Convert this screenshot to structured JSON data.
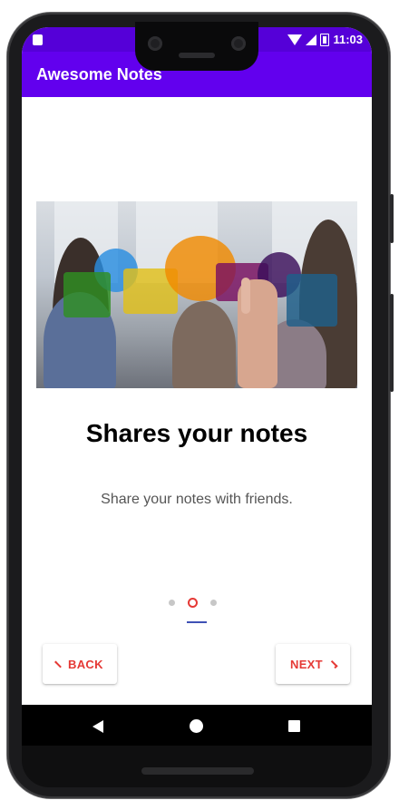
{
  "app": {
    "title": "Awesome Notes"
  },
  "status_bar": {
    "time": "11:03",
    "icons": [
      "sim-card-icon",
      "wifi-icon",
      "signal-icon",
      "battery-icon"
    ]
  },
  "onboarding": {
    "headline": "Shares your notes",
    "description": "Share your notes with friends.",
    "illustration": "people-chat-bubbles-illustration",
    "page_current": 2,
    "page_total": 3
  },
  "buttons": {
    "back_label": "BACK",
    "next_label": "NEXT"
  },
  "nav_bar": {
    "icons": [
      "nav-back-icon",
      "nav-home-icon",
      "nav-recents-icon"
    ]
  },
  "colors": {
    "app_bar": "#6200ee",
    "status_bar": "#5500d8",
    "accent_text": "#e53935",
    "indicator": "#3f51b5"
  }
}
